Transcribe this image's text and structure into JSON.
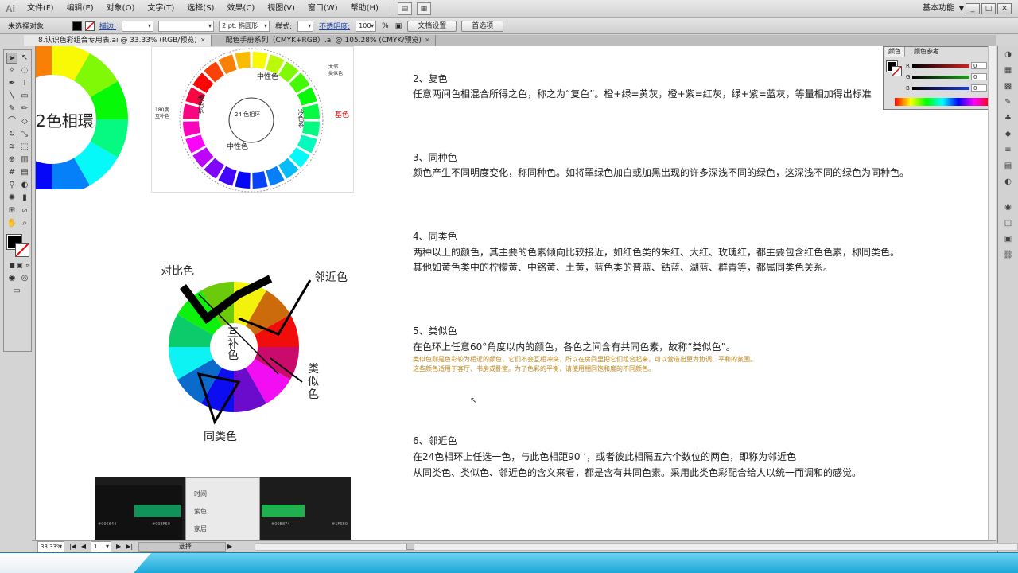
{
  "app": {
    "logo": "Ai"
  },
  "menu": [
    "文件(F)",
    "编辑(E)",
    "对象(O)",
    "文字(T)",
    "选择(S)",
    "效果(C)",
    "视图(V)",
    "窗口(W)",
    "帮助(H)"
  ],
  "workspace": "基本功能",
  "window_controls": [
    "_",
    "□",
    "✕"
  ],
  "control_bar": {
    "selection": "未选择对象",
    "stroke_label": "描边:",
    "brush": "2 pt. 椭圆形",
    "style_label": "样式:",
    "opacity_label": "不透明度:",
    "opacity_value": "100",
    "opacity_unit": "%",
    "doc_setup": "文档设置",
    "preferences": "首选项"
  },
  "tabs": [
    {
      "label": "8.认识色彩组合专用表.ai @ 33.33% (RGB/预览)",
      "active": true
    },
    {
      "label": "配色手册系列（CMYK+RGB）.ai @ 105.28% (CMYK/预览)",
      "active": false
    }
  ],
  "color_panel": {
    "tabs": [
      "颜色",
      "颜色参考"
    ],
    "rows": [
      {
        "label": "R",
        "value": "0",
        "color": "#e01c1c"
      },
      {
        "label": "G",
        "value": "0",
        "color": "#1ca21c"
      },
      {
        "label": "B",
        "value": "0",
        "color": "#1c3ce0"
      }
    ]
  },
  "status": {
    "zoom": "33.33%",
    "page": "1",
    "mode": "选择"
  },
  "figures": {
    "wheel12_label": "2色相環",
    "wheel24": {
      "center": "24 色相环",
      "labels": [
        "中性色",
        "中性色",
        "暖色系",
        "冷色系"
      ],
      "left": "180度\n互补色",
      "top_right": "大邻\n类似色",
      "right": "基色"
    },
    "contrast": {
      "top_left": "对比色",
      "top_right": "邻近色",
      "right_v": "类\n似\n色",
      "bottom": "同类色",
      "center": "互\n补\n色"
    },
    "screenshot": {
      "menu": [
        "时间",
        "紫色",
        "家居"
      ],
      "codes": [
        "#006644",
        "#008F50",
        "#00B874",
        "#1F6B0"
      ]
    }
  },
  "sections": [
    {
      "title": "2、复色",
      "lines": [
        "任意两间色相混合所得之色，称之为“复色”。橙+绿=黄灰，橙+紫=红灰，绿+紫=蓝灰，等量相加得出标准"
      ],
      "notes": []
    },
    {
      "title": "3、同种色",
      "lines": [
        "颜色产生不同明度变化，称同种色。如将翠绿色加白或加黑出现的许多深浅不同的绿色，这深浅不同的绿色为同种色。"
      ],
      "notes": []
    },
    {
      "title": "4、同类色",
      "lines": [
        "两种以上的颜色，其主要的色素倾向比较接近，如红色类的朱红、大红、玫瑰红，都主要包含红色色素，称同类色。",
        "其他如黄色类中的柠檬黄、中铬黄、土黄，蓝色类的普蓝、钴蓝、湖蓝、群青等，都属同类色关系。"
      ],
      "notes": []
    },
    {
      "title": "5、类似色",
      "lines": [
        "在色环上任意60°角度以内的颜色，各色之间含有共同色素，故称“类似色”。"
      ],
      "notes": [
        "类似色则是色彩较为相近的颜色，它们不会互相冲突，所以在房间里把它们组合起来，可以营造出更为协调、平和的氛围。",
        "这些颜色适用于客厅、书房或卧室。为了色彩的平衡，请使用相同饱和度的不同颜色。"
      ]
    },
    {
      "title": "6、邻近色",
      "lines": [
        "在24色相环上任选一色，与此色相距90 ’，或者彼此相隔五六个数位的两色，即称为邻近色",
        "从同类色、类似色、邻近色的含义来看，都是含有共同色素。采用此类色彩配合给人以统一而调和的感觉。"
      ],
      "notes": []
    }
  ]
}
